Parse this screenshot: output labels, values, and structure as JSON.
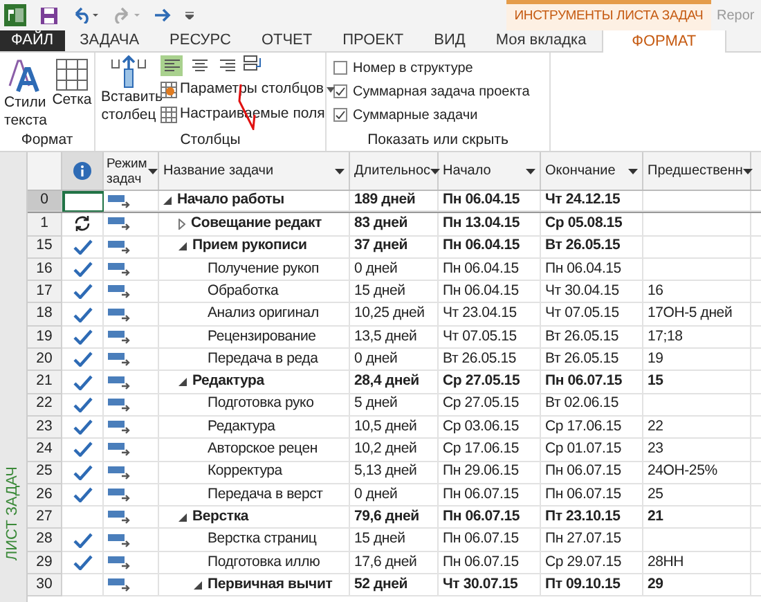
{
  "context_header": {
    "title": "ИНСТРУМЕНТЫ ЛИСТА ЗАДАЧ",
    "next_title": "Repor"
  },
  "tabs": [
    {
      "label": "ФАЙЛ",
      "kind": "file",
      "selected": false
    },
    {
      "label": "ЗАДАЧА",
      "kind": "tab",
      "selected": false
    },
    {
      "label": "РЕСУРС",
      "kind": "tab",
      "selected": false
    },
    {
      "label": "ОТЧЕТ",
      "kind": "tab",
      "selected": false
    },
    {
      "label": "ПРОЕКТ",
      "kind": "tab",
      "selected": false
    },
    {
      "label": "ВИД",
      "kind": "tab",
      "selected": false
    },
    {
      "label": "Моя вкладка",
      "kind": "tab",
      "selected": false
    },
    {
      "label": "ФОРМАТ",
      "kind": "context",
      "selected": true
    }
  ],
  "ribbon": {
    "groups": [
      {
        "label": "Формат",
        "buttons": [
          "Стили текста",
          "Сетка"
        ]
      },
      {
        "label": "Столбцы",
        "insert": "Вставить столбец",
        "align": [
          {
            "selected": true
          },
          {
            "selected": false
          },
          {
            "selected": false
          }
        ],
        "items": [
          "Параметры столбцов",
          "Настраиваемые поля"
        ]
      },
      {
        "label": "Показать или скрыть",
        "checks": [
          {
            "label": "Номер в структуре",
            "checked": false
          },
          {
            "label": "Суммарная задача проекта",
            "checked": true
          },
          {
            "label": "Суммарные задачи",
            "checked": true
          }
        ]
      }
    ]
  },
  "side_label": "ЛИСТ ЗАДАЧ",
  "table": {
    "columns": [
      "Режим задач",
      "Название задачи",
      "Длительнос",
      "Начало",
      "Окончание",
      "Предшественн"
    ],
    "rows": [
      {
        "id": "0",
        "kind": "summary",
        "complete": false,
        "recurring": false,
        "selected": true,
        "expanded": true,
        "name": "Начало работы",
        "duration": "189 дней",
        "start": "Пн 06.04.15",
        "finish": "Чт 24.12.15",
        "children": [
          {
            "id": "1",
            "kind": "summary",
            "complete": false,
            "recurring": true,
            "selected": false,
            "expanded": false,
            "name": "Совещание редакт",
            "duration": "83 дней",
            "start": "Пн 13.04.15",
            "finish": "Ср 05.08.15"
          },
          {
            "id": "15",
            "kind": "summary",
            "complete": true,
            "recurring": false,
            "selected": false,
            "expanded": true,
            "name": "Прием рукописи",
            "duration": "37 дней",
            "start": "Пн 06.04.15",
            "finish": "Вт 26.05.15",
            "children": [
              {
                "id": "16",
                "kind": "task",
                "complete": true,
                "recurring": false,
                "selected": false,
                "name": "Получение рукоп",
                "duration": "0 дней",
                "start": "Пн 06.04.15",
                "finish": "Пн 06.04.15"
              },
              {
                "id": "17",
                "kind": "task",
                "complete": true,
                "recurring": false,
                "selected": false,
                "name": "Обработка",
                "duration": "15 дней",
                "start": "Пн 06.04.15",
                "finish": "Чт 30.04.15",
                "pred": "16"
              },
              {
                "id": "18",
                "kind": "task",
                "complete": true,
                "recurring": false,
                "selected": false,
                "name": "Анализ оригинал",
                "duration": "10,25 дней",
                "start": "Чт 23.04.15",
                "finish": "Чт 07.05.15",
                "pred": "17ОН-5 дней"
              },
              {
                "id": "19",
                "kind": "task",
                "complete": true,
                "recurring": false,
                "selected": false,
                "name": "Рецензирование",
                "duration": "13,5 дней",
                "start": "Чт 07.05.15",
                "finish": "Вт 26.05.15",
                "pred": "17;18"
              },
              {
                "id": "20",
                "kind": "task",
                "complete": true,
                "recurring": false,
                "selected": false,
                "name": "Передача в реда",
                "duration": "0 дней",
                "start": "Вт 26.05.15",
                "finish": "Вт 26.05.15",
                "pred": "19"
              }
            ]
          },
          {
            "id": "21",
            "kind": "summary",
            "complete": true,
            "recurring": false,
            "selected": false,
            "expanded": true,
            "name": "Редактура",
            "duration": "28,4 дней",
            "start": "Ср 27.05.15",
            "finish": "Пн 06.07.15",
            "pred": "15",
            "children": [
              {
                "id": "22",
                "kind": "task",
                "complete": true,
                "recurring": false,
                "selected": false,
                "name": "Подготовка руко",
                "duration": "5 дней",
                "start": "Ср 27.05.15",
                "finish": "Вт 02.06.15"
              },
              {
                "id": "23",
                "kind": "task",
                "complete": true,
                "recurring": false,
                "selected": false,
                "name": "Редактура",
                "duration": "10,5 дней",
                "start": "Ср 03.06.15",
                "finish": "Ср 17.06.15",
                "pred": "22"
              },
              {
                "id": "24",
                "kind": "task",
                "complete": true,
                "recurring": false,
                "selected": false,
                "name": "Авторское рецен",
                "duration": "10,2 дней",
                "start": "Ср 17.06.15",
                "finish": "Ср 01.07.15",
                "pred": "23"
              },
              {
                "id": "25",
                "kind": "task",
                "complete": true,
                "recurring": false,
                "selected": false,
                "name": "Корректура",
                "duration": "5,13 дней",
                "start": "Пн 29.06.15",
                "finish": "Пн 06.07.15",
                "pred": "24ОН-25%"
              },
              {
                "id": "26",
                "kind": "task",
                "complete": true,
                "recurring": false,
                "selected": false,
                "name": "Передача в верст",
                "duration": "0 дней",
                "start": "Пн 06.07.15",
                "finish": "Пн 06.07.15",
                "pred": "25"
              }
            ]
          },
          {
            "id": "27",
            "kind": "summary",
            "complete": false,
            "recurring": false,
            "selected": false,
            "expanded": true,
            "name": "Верстка",
            "duration": "79,6 дней",
            "start": "Пн 06.07.15",
            "finish": "Пт 23.10.15",
            "pred": "21",
            "children": [
              {
                "id": "28",
                "kind": "task",
                "complete": true,
                "recurring": false,
                "selected": false,
                "name": "Верстка страниц",
                "duration": "15 дней",
                "start": "Пн 06.07.15",
                "finish": "Пн 27.07.15"
              },
              {
                "id": "29",
                "kind": "task",
                "complete": true,
                "recurring": false,
                "selected": false,
                "name": "Подготовка иллю",
                "duration": "17,6 дней",
                "start": "Пн 06.07.15",
                "finish": "Ср 29.07.15",
                "pred": "28НН"
              },
              {
                "id": "30",
                "kind": "summary",
                "complete": false,
                "recurring": false,
                "selected": false,
                "expanded": true,
                "name": "Первичная вычит",
                "duration": "52 дней",
                "start": "Чт 30.07.15",
                "finish": "Пт 09.10.15",
                "pred": "29"
              }
            ]
          }
        ]
      }
    ]
  }
}
